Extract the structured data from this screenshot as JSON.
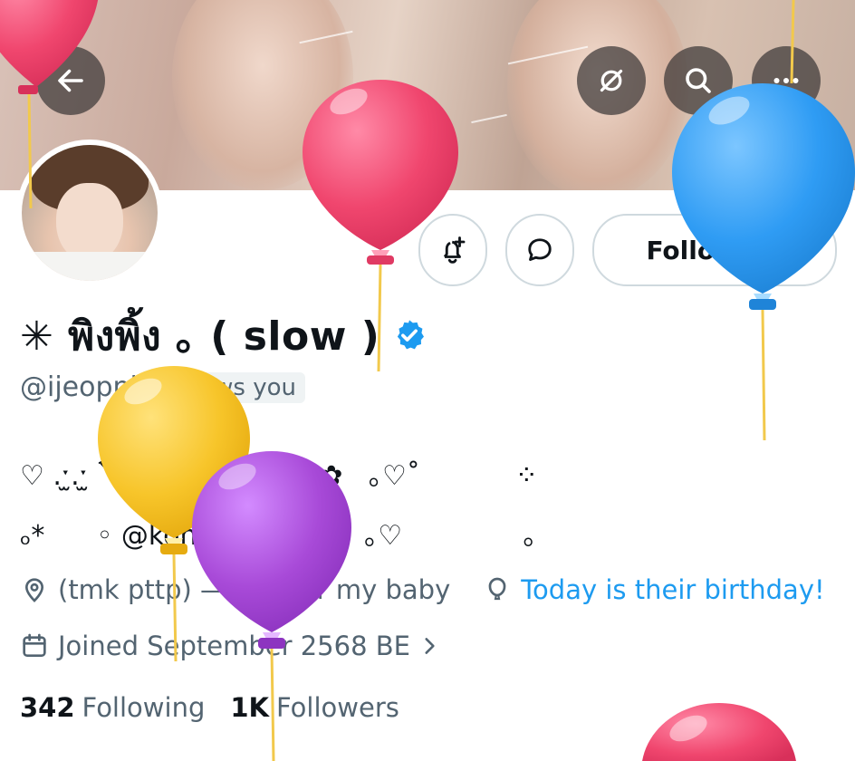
{
  "header": {
    "back_icon": "arrow-left-icon",
    "translate_icon": "slashed-circle-icon",
    "search_icon": "search-icon",
    "more_icon": "more-dots-icon"
  },
  "profile": {
    "display_name": "✳︎ พิงพิ้ง ｡ ( slow )",
    "handle": "@ijeopni",
    "follows_you": "Follows you",
    "bio_line1": "♡ .ˑ̫.ˑ̫ `͡`৹ ρ      fan acc ✿   ｡♡˚           ⁘",
    "bio_line2": "ₒ*      ◦ @kongjiro_ ｡ᶜᶜ ·    ｡♡              ｡",
    "bio_mention": "@kongjiro_",
    "location": "(tmk pttp) —— ✿ for my baby",
    "birthday": "Today is their birthday!",
    "joined": "Joined September 2568 BE",
    "following_count": "342",
    "following_label": "Following",
    "followers_count": "1K",
    "followers_label": "Followers"
  },
  "actions": {
    "following_button": "Following",
    "notify_icon": "bell-plus-icon",
    "message_icon": "message-bubble-icon"
  },
  "colors": {
    "accent": "#1d9bf0",
    "muted_text": "#536471",
    "balloon_pink": "#f0466e",
    "balloon_blue": "#2f9cf4",
    "balloon_yellow": "#f7c52a",
    "balloon_purple": "#a84ad8"
  }
}
